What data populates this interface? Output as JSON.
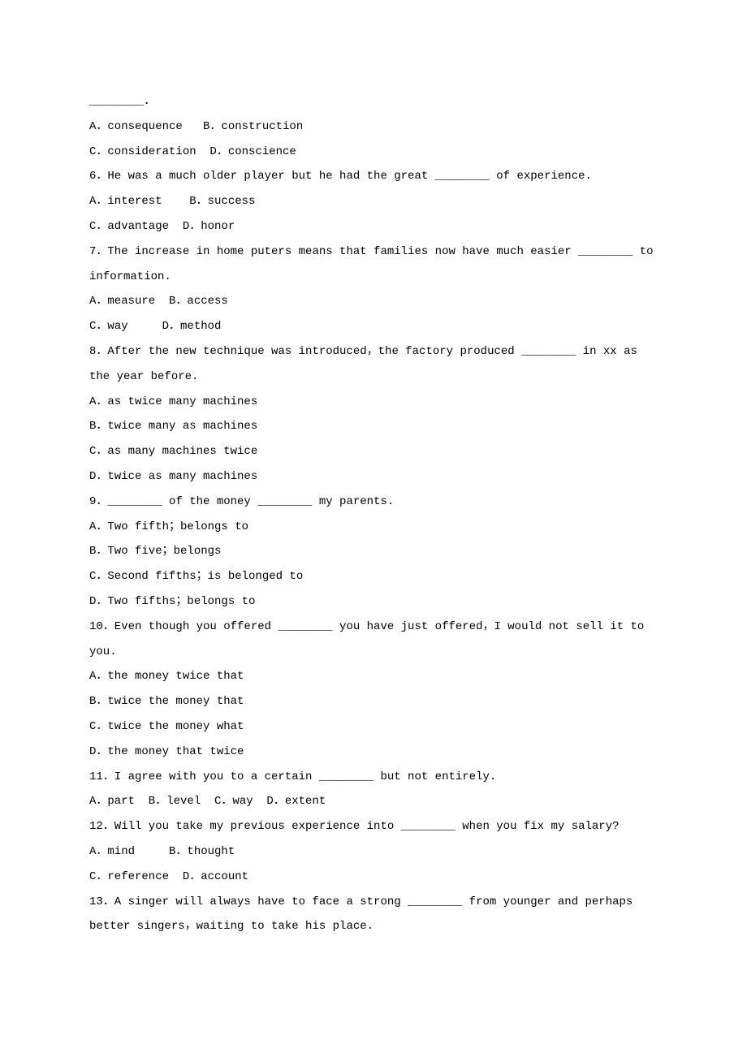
{
  "lines": [
    "________．",
    "A．consequence   B．construction",
    "C．consideration  D．conscience",
    "6．He was a much older player but he had the great ________ of experience.",
    "A．interest    B．success",
    "C．advantage  D．honor",
    "7．The increase in home puters means that families now have much easier ________ to information.",
    "A．measure  B．access",
    "C．way     D．method",
    "8．After the new technique was introduced，the factory produced ________ in xx as the year before.",
    "A．as twice many machines",
    "B．twice many as machines",
    "C．as many machines twice",
    "D．twice as many machines",
    "9．________ of the money ________ my parents.",
    "A．Two fifth；belongs to",
    "B．Two five；belongs",
    "C．Second fifths；is belonged to",
    "D．Two fifths；belongs to",
    "10．Even though you offered ________ you have just offered，I would not sell it to you.",
    "A．the money twice that",
    "B．twice the money that",
    "C．twice the money what",
    "D．the money that twice",
    "11．I agree with you to a certain ________ but not entirely.",
    "A．part  B．level  C．way  D．extent",
    "12．Will you take my previous experience into ________ when you fix my salary?",
    "A．mind     B．thought",
    "C．reference  D．account",
    "13．A singer will always have to face a strong ________ from younger and perhaps better singers，waiting to take his place."
  ]
}
